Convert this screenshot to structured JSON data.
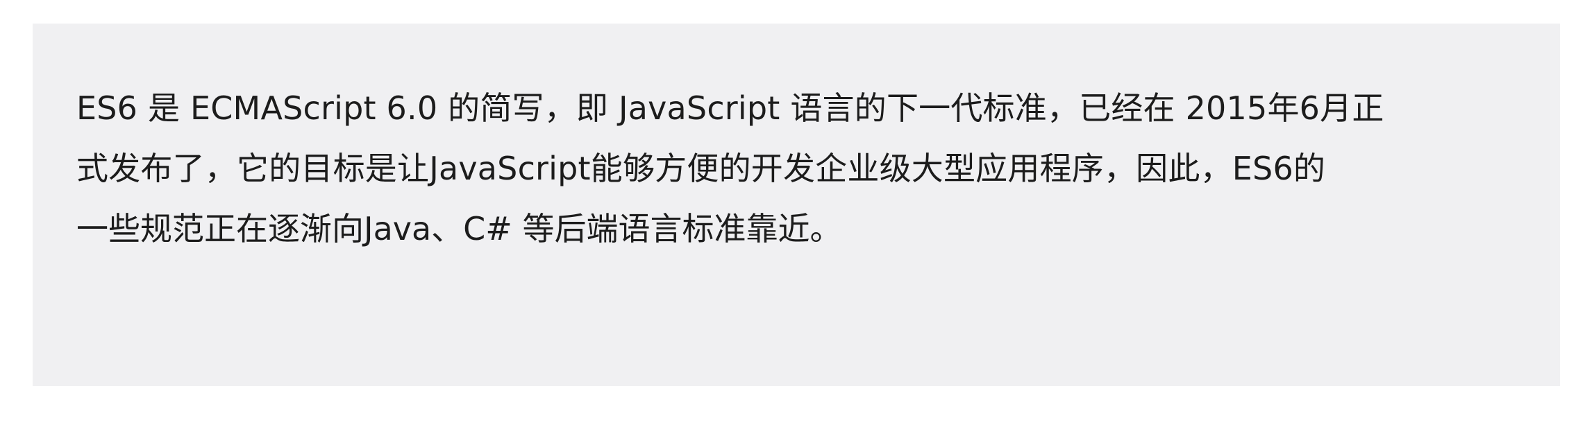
{
  "document": {
    "paragraph": {
      "lines": [
        "ES6 是 ECMAScript 6.0 的简写，即 JavaScript 语言的下一代标准，已经在 2015年6月正",
        "式发布了，它的目标是让JavaScript能够方便的开发企业级大型应用程序，因此，ES6的",
        "一些规范正在逐渐向Java、C# 等后端语言标准靠近。"
      ]
    },
    "colors": {
      "background": "#ffffff",
      "box_background": "#f0f0f2",
      "text": "#1c1c1c"
    }
  }
}
